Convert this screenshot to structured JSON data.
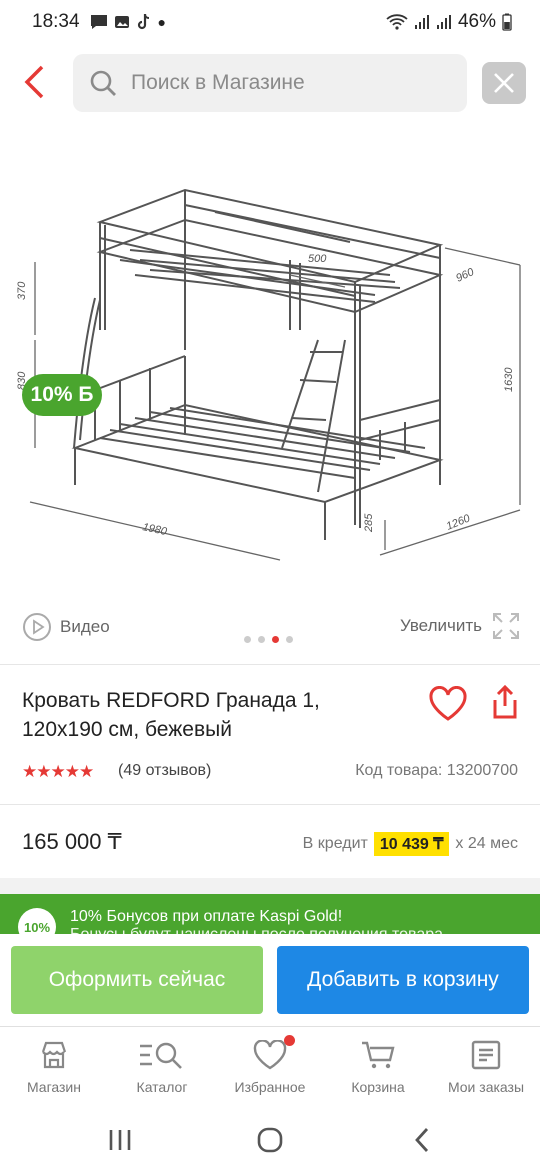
{
  "status_bar": {
    "time": "18:34",
    "battery": "46%"
  },
  "search": {
    "placeholder": "Поиск в Магазине"
  },
  "image": {
    "bonus_badge": "10% Б",
    "dimensions": [
      "500",
      "960",
      "370",
      "830",
      "1630",
      "1980",
      "285",
      "1260"
    ]
  },
  "media": {
    "video_label": "Видео",
    "zoom_label": "Увеличить"
  },
  "product": {
    "title": "Кровать REDFORD Гранада 1, 120x190 см, бежевый",
    "stars": "★★★★★",
    "reviews": "(49 отзывов)",
    "code": "Код товара: 13200700",
    "price": "165 000 ₸",
    "credit_prefix": "В кредит",
    "credit_amount": "10 439 ₸",
    "credit_suffix": "х 24 мес"
  },
  "kaspi_banner": {
    "circle": "10%",
    "line1": "10% Бонусов при оплате Kaspi Gold!",
    "line2": "Бонусы будут начислены после получения товара"
  },
  "actions": {
    "buy_now": "Оформить сейчас",
    "add_to_cart": "Добавить в корзину"
  },
  "bottom_nav": {
    "items": [
      {
        "label": "Магазин",
        "icon": "store-icon"
      },
      {
        "label": "Каталог",
        "icon": "catalog-search-icon"
      },
      {
        "label": "Избранное",
        "icon": "heart-icon"
      },
      {
        "label": "Корзина",
        "icon": "cart-icon"
      },
      {
        "label": "Мои заказы",
        "icon": "orders-icon"
      }
    ]
  },
  "colors": {
    "accent_red": "#e53935",
    "kaspi_green": "#4aa52e",
    "buy_green": "#8fd36b",
    "cart_blue": "#1e88e5",
    "credit_yellow": "#ffe000"
  }
}
